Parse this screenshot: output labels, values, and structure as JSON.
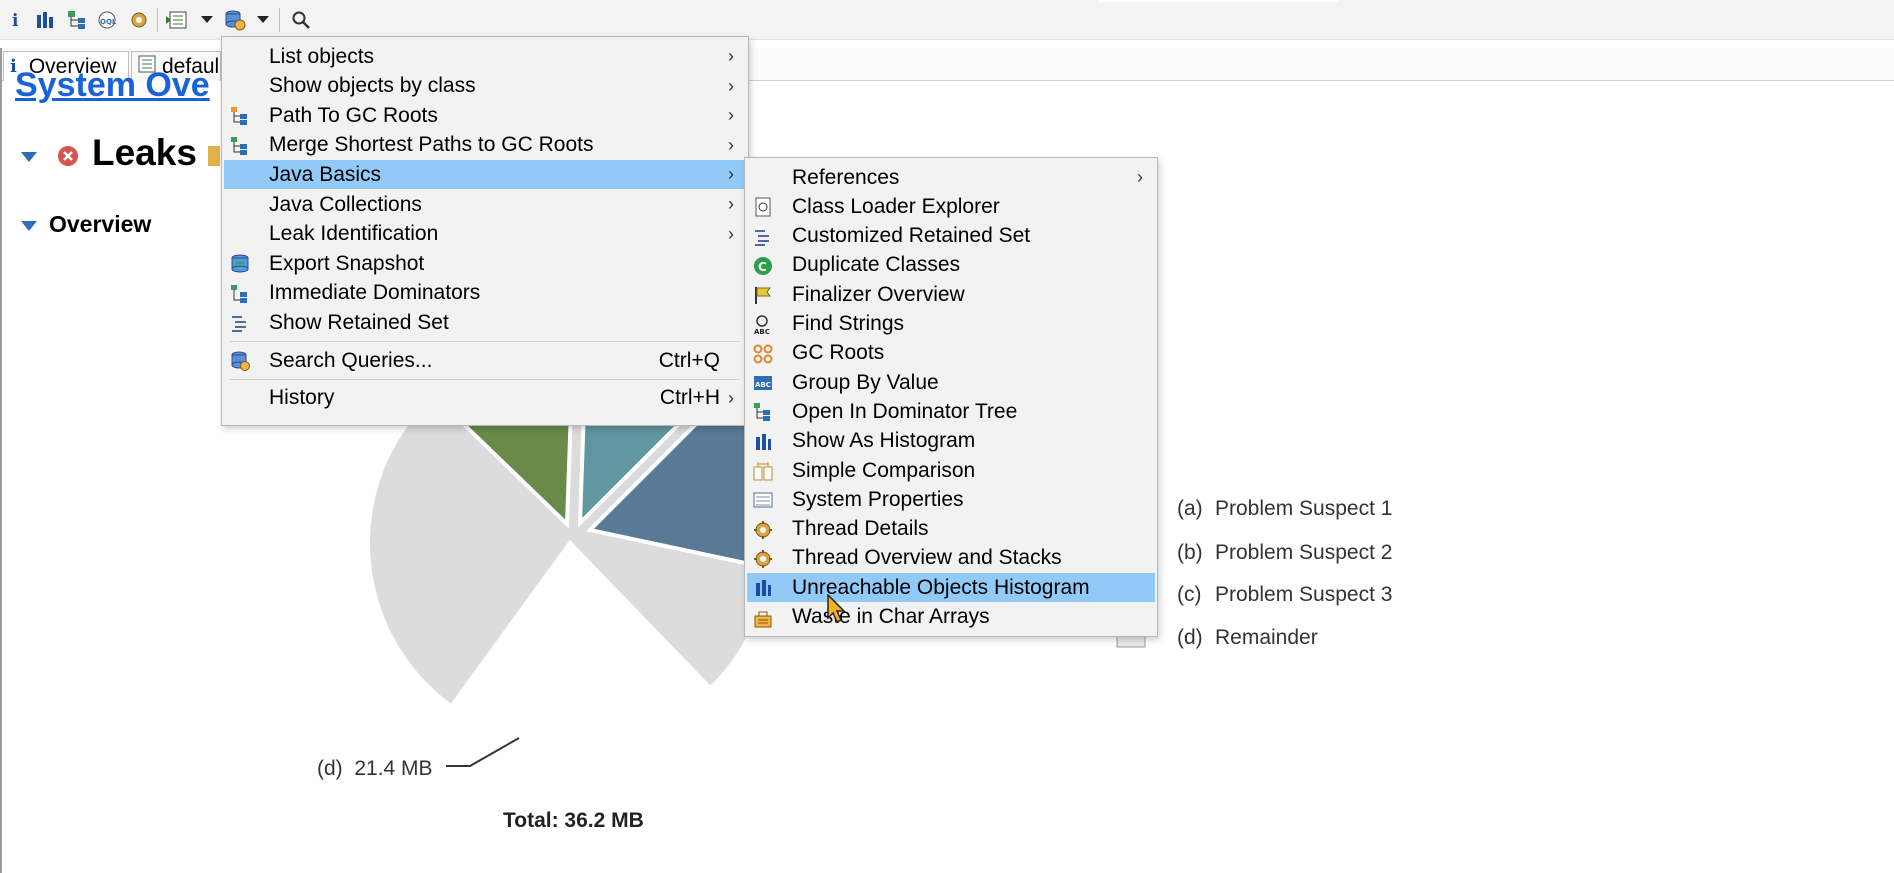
{
  "toolbar": {
    "buttons": [
      "info-icon",
      "histogram-icon",
      "dominator-tree-icon",
      "oql-icon",
      "thread-icon",
      "run-report-icon",
      "query-browser-icon",
      "search-icon"
    ]
  },
  "tabs": {
    "overview_label": "Overview",
    "default_label": "defaul"
  },
  "page": {
    "system_overview_title": "System Ove",
    "leaks_title": "Leaks",
    "overview_title": "Overview"
  },
  "chart_data": {
    "type": "pie",
    "legend": [
      {
        "code": "(a)",
        "label": "Problem Suspect 1"
      },
      {
        "code": "(b)",
        "label": "Problem Suspect 2"
      },
      {
        "code": "(c)",
        "label": "Problem Suspect 3"
      },
      {
        "code": "(d)",
        "label": "Remainder"
      }
    ],
    "slice_labels": [
      {
        "code": "(d)",
        "value": "21.4 MB"
      }
    ],
    "total": "Total: 36.2 MB",
    "colors": {
      "a": "#6a8a4a",
      "b": "#5f96a0",
      "c": "#587a96",
      "d": "#dcdcdc"
    }
  },
  "main_menu": {
    "items": [
      {
        "label": "List objects",
        "submenu": true,
        "icon": ""
      },
      {
        "label": "Show objects by class",
        "submenu": true,
        "icon": ""
      },
      {
        "label": "Path To GC Roots",
        "submenu": true,
        "icon": "path-to-gc-roots-icon"
      },
      {
        "label": "Merge Shortest Paths to GC Roots",
        "submenu": true,
        "icon": "merge-paths-icon"
      },
      {
        "label": "Java Basics",
        "submenu": true,
        "icon": "",
        "selected": true
      },
      {
        "label": "Java Collections",
        "submenu": true,
        "icon": ""
      },
      {
        "label": "Leak Identification",
        "submenu": true,
        "icon": ""
      },
      {
        "label": "Export Snapshot",
        "submenu": false,
        "icon": "export-snapshot-icon"
      },
      {
        "label": "Immediate Dominators",
        "submenu": false,
        "icon": "immediate-dominators-icon"
      },
      {
        "label": "Show Retained Set",
        "submenu": false,
        "icon": "retained-set-icon"
      },
      {
        "label": "Search Queries...",
        "shortcut": "Ctrl+Q",
        "icon": "search-queries-icon"
      },
      {
        "label": "History",
        "shortcut": "Ctrl+H",
        "submenu": true,
        "icon": ""
      }
    ]
  },
  "sub_menu": {
    "items": [
      {
        "label": "References",
        "submenu": true,
        "icon": ""
      },
      {
        "label": "Class Loader Explorer",
        "icon": "class-loader-icon"
      },
      {
        "label": "Customized Retained Set",
        "icon": "retained-set-icon"
      },
      {
        "label": "Duplicate Classes",
        "icon": "duplicate-classes-icon"
      },
      {
        "label": "Finalizer Overview",
        "icon": "finalizer-icon"
      },
      {
        "label": "Find Strings",
        "icon": "find-strings-icon"
      },
      {
        "label": "GC Roots",
        "icon": "gc-roots-icon"
      },
      {
        "label": "Group By Value",
        "icon": "group-by-value-icon"
      },
      {
        "label": "Open In Dominator Tree",
        "icon": "dominator-tree-icon"
      },
      {
        "label": "Show As Histogram",
        "icon": "histogram-icon"
      },
      {
        "label": "Simple Comparison",
        "icon": "comparison-icon"
      },
      {
        "label": "System Properties",
        "icon": "system-properties-icon"
      },
      {
        "label": "Thread Details",
        "icon": "thread-icon"
      },
      {
        "label": "Thread Overview and Stacks",
        "icon": "thread-icon"
      },
      {
        "label": "Unreachable Objects Histogram",
        "icon": "histogram-icon",
        "selected": true
      },
      {
        "label": "Waste in Char Arrays",
        "icon": "waste-icon"
      }
    ]
  }
}
